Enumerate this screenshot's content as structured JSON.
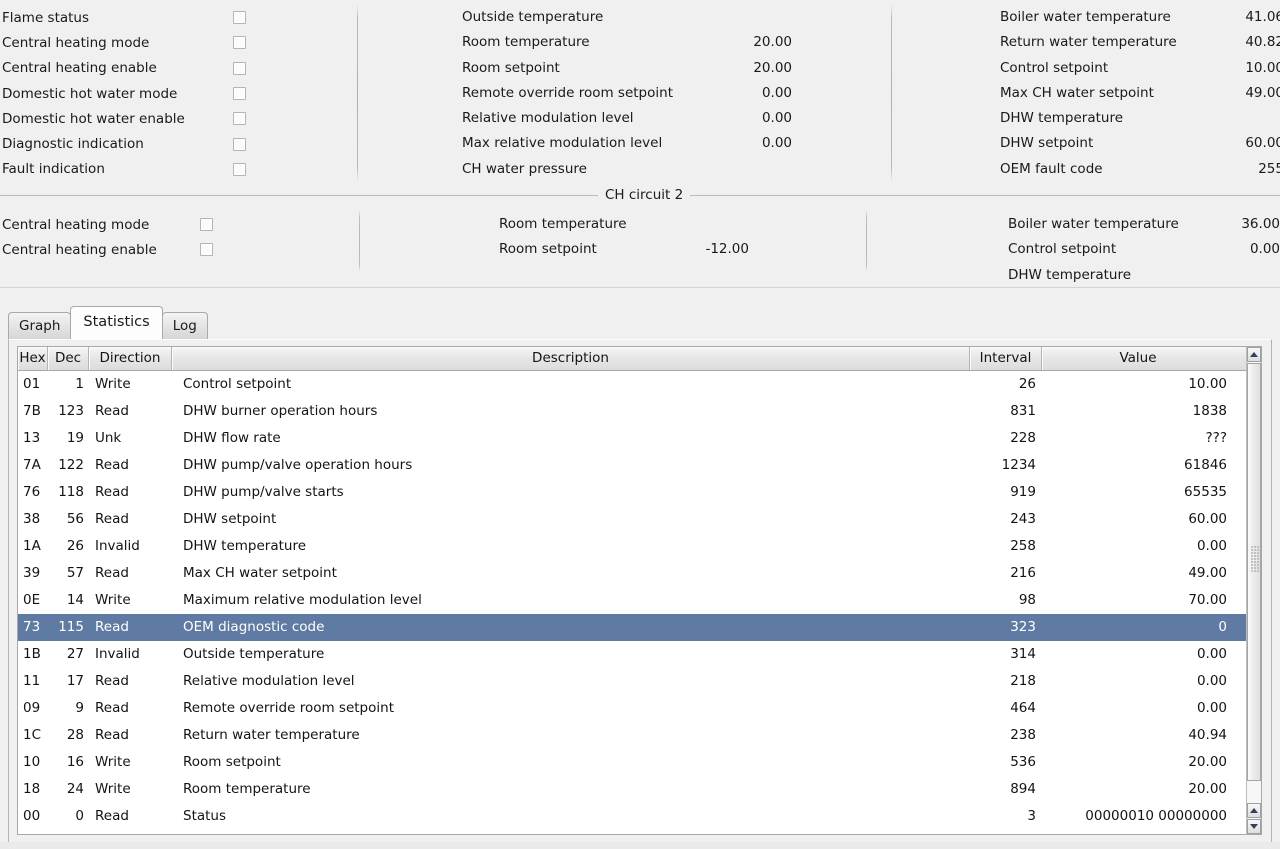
{
  "circuit1": {
    "checkboxes": [
      {
        "label": "Flame status",
        "checked": false
      },
      {
        "label": "Central heating mode",
        "checked": false
      },
      {
        "label": "Central heating enable",
        "checked": false
      },
      {
        "label": "Domestic hot water mode",
        "checked": false
      },
      {
        "label": "Domestic hot water enable",
        "checked": false
      },
      {
        "label": "Diagnostic indication",
        "checked": false
      },
      {
        "label": "Fault indication",
        "checked": false
      }
    ],
    "middle": [
      {
        "label": "Outside temperature",
        "value": ""
      },
      {
        "label": "Room temperature",
        "value": "20.00"
      },
      {
        "label": "Room setpoint",
        "value": "20.00"
      },
      {
        "label": "Remote override room setpoint",
        "value": "0.00"
      },
      {
        "label": "Relative modulation level",
        "value": "0.00"
      },
      {
        "label": "Max relative modulation level",
        "value": "0.00"
      },
      {
        "label": "CH water pressure",
        "value": ""
      }
    ],
    "right": [
      {
        "label": "Boiler water temperature",
        "value": "41.06"
      },
      {
        "label": "Return water temperature",
        "value": "40.82"
      },
      {
        "label": "Control setpoint",
        "value": "10.00"
      },
      {
        "label": "Max CH water setpoint",
        "value": "49.00"
      },
      {
        "label": "DHW temperature",
        "value": ""
      },
      {
        "label": "DHW setpoint",
        "value": "60.00"
      },
      {
        "label": "OEM fault code",
        "value": "255"
      }
    ]
  },
  "circuit2": {
    "title": "CH circuit 2",
    "checkboxes": [
      {
        "label": "Central heating mode",
        "checked": false
      },
      {
        "label": "Central heating enable",
        "checked": false
      }
    ],
    "middle": [
      {
        "label": "Room temperature",
        "value": ""
      },
      {
        "label": "Room setpoint",
        "value": "-12.00"
      }
    ],
    "right": [
      {
        "label": "Boiler water temperature",
        "value": "36.00"
      },
      {
        "label": "Control setpoint",
        "value": "0.00"
      },
      {
        "label": "DHW temperature",
        "value": ""
      }
    ]
  },
  "tabs": [
    {
      "label": "Graph",
      "active": false
    },
    {
      "label": "Statistics",
      "active": true
    },
    {
      "label": "Log",
      "active": false
    }
  ],
  "table": {
    "columns": [
      "Hex",
      "Dec",
      "Direction",
      "Description",
      "Interval",
      "Value"
    ],
    "selected_index": 9,
    "rows": [
      {
        "hex": "01",
        "dec": "1",
        "direction": "Write",
        "description": "Control setpoint",
        "interval": "26",
        "value": "10.00"
      },
      {
        "hex": "7B",
        "dec": "123",
        "direction": "Read",
        "description": "DHW burner operation hours",
        "interval": "831",
        "value": "1838"
      },
      {
        "hex": "13",
        "dec": "19",
        "direction": "Unk",
        "description": "DHW flow rate",
        "interval": "228",
        "value": "???"
      },
      {
        "hex": "7A",
        "dec": "122",
        "direction": "Read",
        "description": "DHW pump/valve operation hours",
        "interval": "1234",
        "value": "61846"
      },
      {
        "hex": "76",
        "dec": "118",
        "direction": "Read",
        "description": "DHW pump/valve starts",
        "interval": "919",
        "value": "65535"
      },
      {
        "hex": "38",
        "dec": "56",
        "direction": "Read",
        "description": "DHW setpoint",
        "interval": "243",
        "value": "60.00"
      },
      {
        "hex": "1A",
        "dec": "26",
        "direction": "Invalid",
        "description": "DHW temperature",
        "interval": "258",
        "value": "0.00"
      },
      {
        "hex": "39",
        "dec": "57",
        "direction": "Read",
        "description": "Max CH water setpoint",
        "interval": "216",
        "value": "49.00"
      },
      {
        "hex": "0E",
        "dec": "14",
        "direction": "Write",
        "description": "Maximum relative modulation level",
        "interval": "98",
        "value": "70.00"
      },
      {
        "hex": "73",
        "dec": "115",
        "direction": "Read",
        "description": "OEM diagnostic code",
        "interval": "323",
        "value": "0"
      },
      {
        "hex": "1B",
        "dec": "27",
        "direction": "Invalid",
        "description": "Outside temperature",
        "interval": "314",
        "value": "0.00"
      },
      {
        "hex": "11",
        "dec": "17",
        "direction": "Read",
        "description": "Relative modulation level",
        "interval": "218",
        "value": "0.00"
      },
      {
        "hex": "09",
        "dec": "9",
        "direction": "Read",
        "description": "Remote override room setpoint",
        "interval": "464",
        "value": "0.00"
      },
      {
        "hex": "1C",
        "dec": "28",
        "direction": "Read",
        "description": "Return water temperature",
        "interval": "238",
        "value": "40.94"
      },
      {
        "hex": "10",
        "dec": "16",
        "direction": "Write",
        "description": "Room setpoint",
        "interval": "536",
        "value": "20.00"
      },
      {
        "hex": "18",
        "dec": "24",
        "direction": "Write",
        "description": "Room temperature",
        "interval": "894",
        "value": "20.00"
      },
      {
        "hex": "00",
        "dec": "0",
        "direction": "Read",
        "description": "Status",
        "interval": "3",
        "value": "00000010 00000000"
      }
    ]
  },
  "colors": {
    "selection": "#5f7ba3",
    "panel_bg": "#f0f0f0",
    "table_bg": "#ffffff"
  }
}
